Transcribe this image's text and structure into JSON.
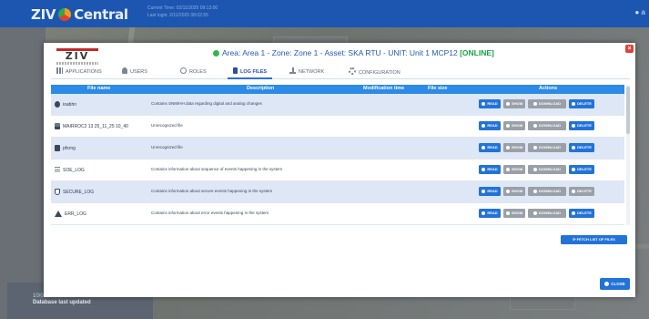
{
  "app": {
    "brand": "Central",
    "time_line1": "Current Time: 02/11/2025 09:13:00",
    "time_line2": "Last login: 2/11/2025 08:02:55",
    "user_initial": "a"
  },
  "background": {
    "last_updated_date": "10/02/2025 12:53:41",
    "last_updated_label": "Database last updated"
  },
  "modal": {
    "title_prefix": "Area: Area 1 - Zone: Zone 1 - Asset: SKA RTU - UNIT: Unit 1 MCP12 ",
    "status": "[ONLINE]",
    "logo_text": "ZIV",
    "close_icon": "close-icon",
    "tabs": [
      {
        "label": "APPLICATIONS",
        "icon": "grid-icon"
      },
      {
        "label": "USERS",
        "icon": "users-icon"
      },
      {
        "label": "ROLES",
        "icon": "roles-icon"
      },
      {
        "label": "LOG FILES",
        "icon": "file-icon",
        "active": true
      },
      {
        "label": "NETWORK",
        "icon": "network-icon"
      },
      {
        "label": "CONFIGURATION",
        "icon": "gear-icon"
      }
    ],
    "columns": {
      "name": "File name",
      "description": "Description",
      "modification_time": "Modification time",
      "size": "File size",
      "actions": "Actions"
    },
    "rows": [
      {
        "icon": "settings-icon",
        "name": "ioabhn",
        "description": "Contains SNM/HH data regarding digital and analog changes"
      },
      {
        "icon": "disk-icon",
        "name": "MAIRROC2 13 25_11_25 10_40",
        "description": "Unrecognized file"
      },
      {
        "icon": "disk-icon",
        "name": "pfsrng",
        "description": "Unrecognized file"
      },
      {
        "icon": "list-icon",
        "name": "SOE_LOG",
        "description": "Contains information about sequence of events happening in the system"
      },
      {
        "icon": "shield-icon",
        "name": "SECURE_LOG",
        "description": "Contains information about secure events happening in the system"
      },
      {
        "icon": "warning-icon",
        "name": "ERR_LOG",
        "description": "Contains information about error events happening in the system"
      }
    ],
    "buttons": {
      "read": "READ",
      "show": "SHOW",
      "download": "DOWNLOAD",
      "delete": "DELETE",
      "fetch": "FETCH LIST OF FILES",
      "close": "CLOSE"
    },
    "colors": {
      "accent": "#2b8be6",
      "primary_button": "#2273d8",
      "disabled_button": "#9aa0a8",
      "online": "#19a04a",
      "close": "#e0413a"
    }
  }
}
